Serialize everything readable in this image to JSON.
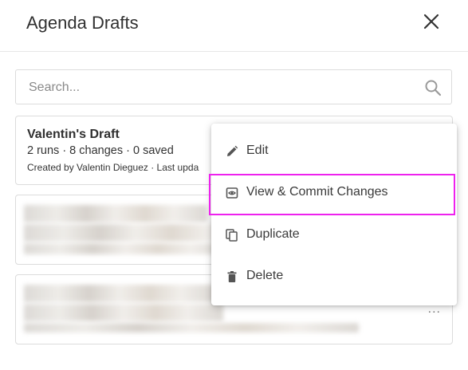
{
  "header": {
    "title": "Agenda Drafts",
    "close_icon": "close-icon"
  },
  "search": {
    "placeholder": "Search...",
    "icon": "search-icon"
  },
  "drafts": [
    {
      "title": "Valentin's Draft",
      "stats": "2 runs · 8 changes · 0 saved",
      "meta": "Created by Valentin Dieguez · Last upda"
    }
  ],
  "menu": {
    "items": [
      {
        "label": "Edit",
        "icon": "pencil-icon"
      },
      {
        "label": "View & Commit Changes",
        "icon": "eye-icon"
      },
      {
        "label": "Duplicate",
        "icon": "duplicate-icon"
      },
      {
        "label": "Delete",
        "icon": "trash-icon"
      }
    ]
  },
  "more_label": "..."
}
